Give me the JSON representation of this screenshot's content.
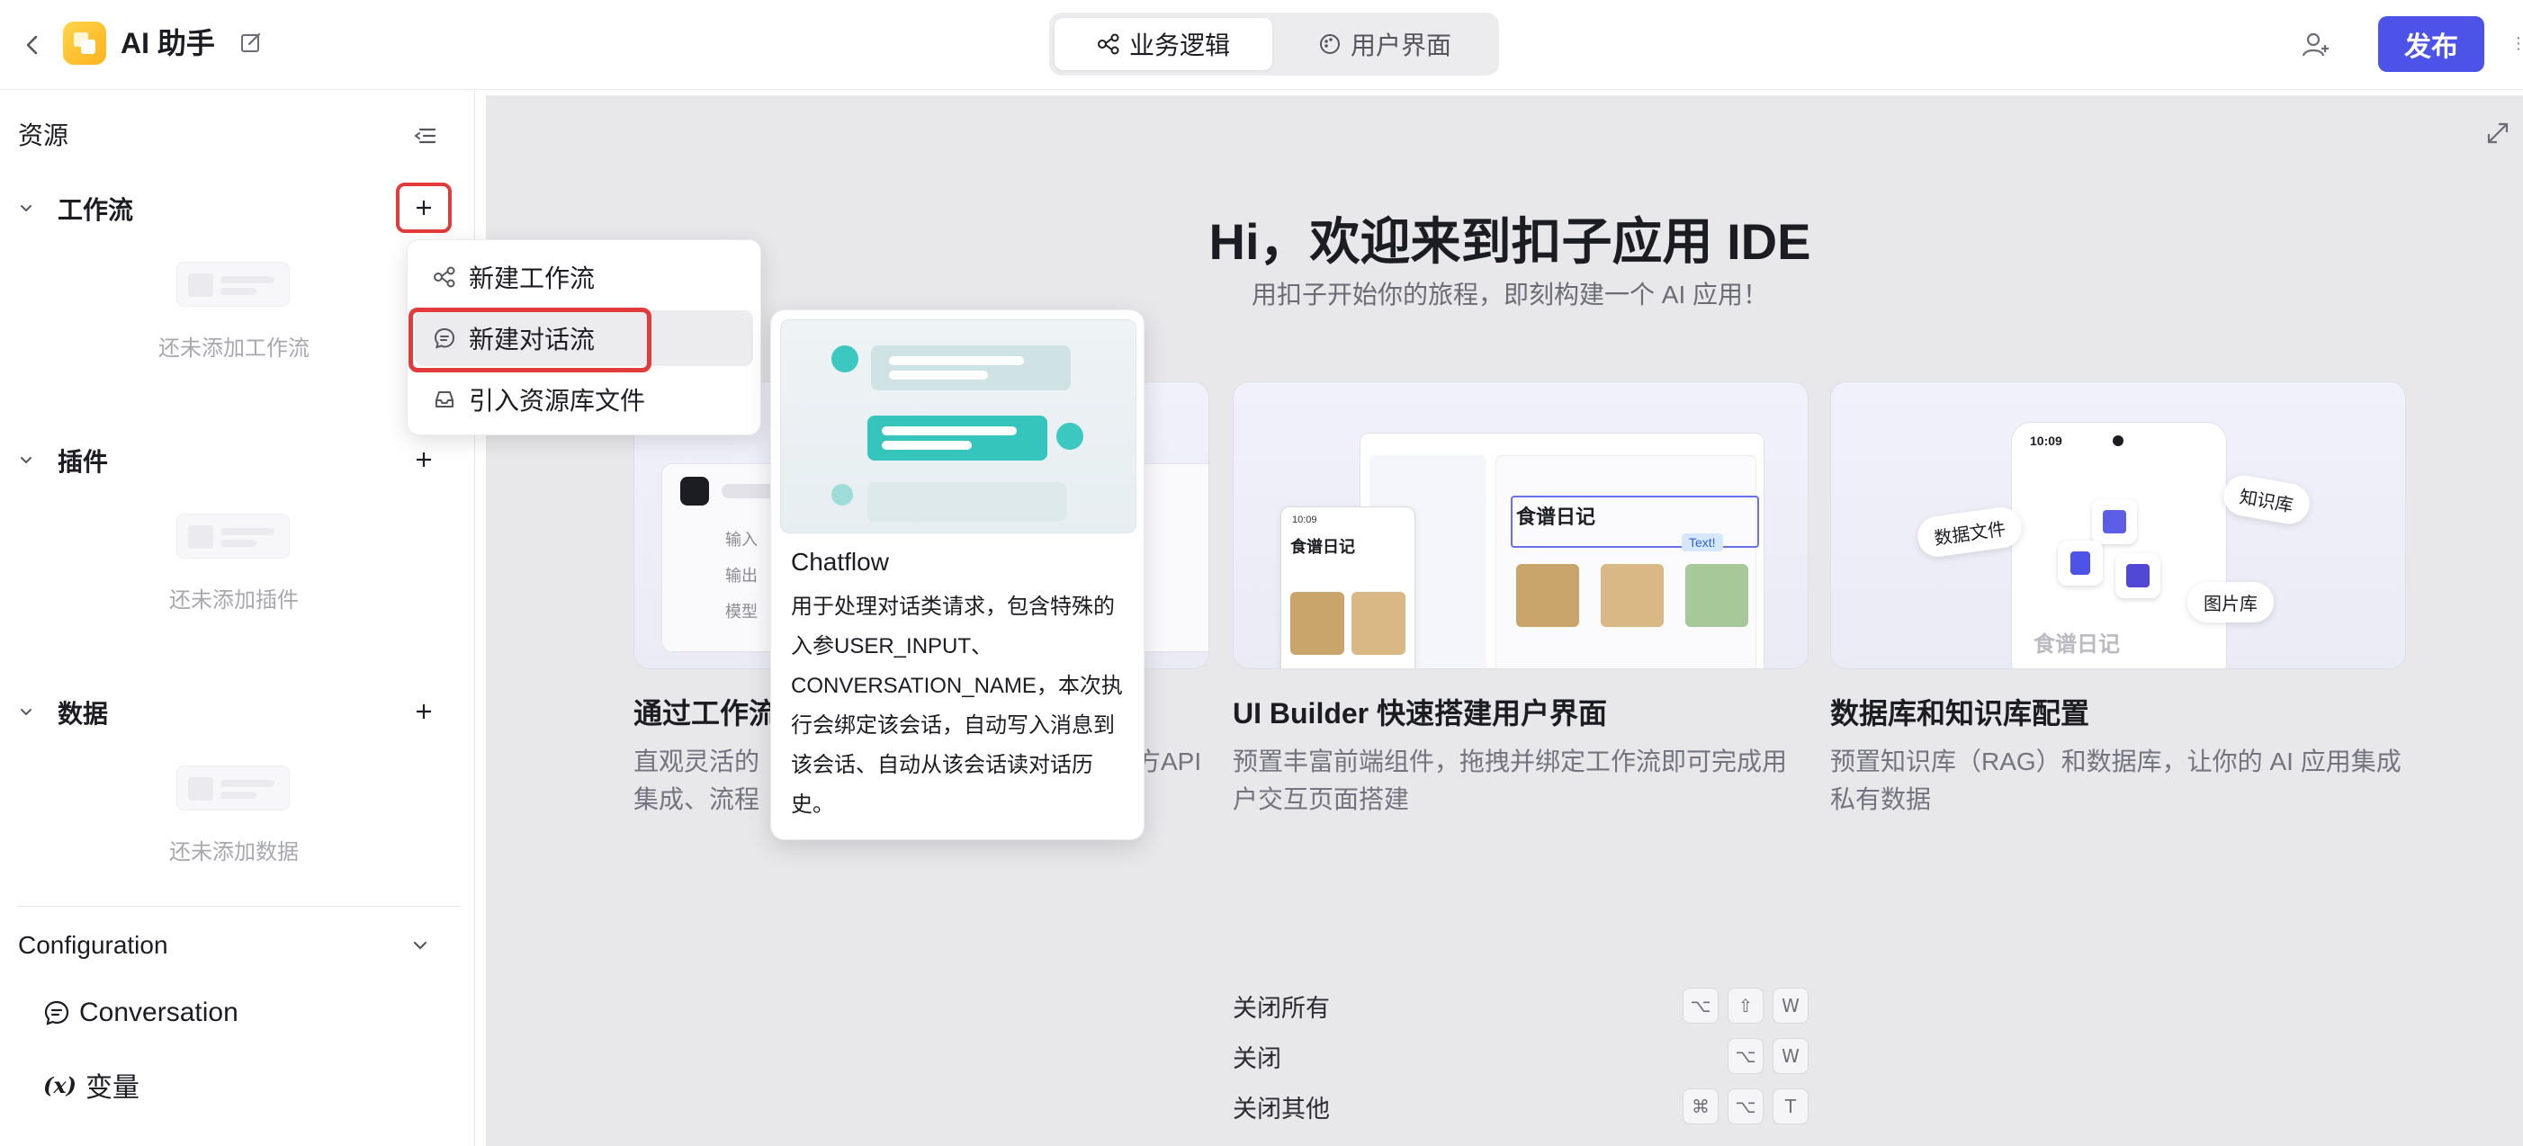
{
  "header": {
    "app_title": "AI 助手",
    "tabs": [
      {
        "label": "业务逻辑",
        "active": true
      },
      {
        "label": "用户界面",
        "active": false
      }
    ],
    "publish_label": "发布"
  },
  "sidebar": {
    "title": "资源",
    "sections": [
      {
        "label": "工作流",
        "empty_text": "还未添加工作流"
      },
      {
        "label": "插件",
        "empty_text": "还未添加插件"
      },
      {
        "label": "数据",
        "empty_text": "还未添加数据"
      }
    ],
    "configuration": {
      "label": "Configuration",
      "items": [
        {
          "label": "Conversation",
          "icon": "chat-bubble-icon"
        },
        {
          "label": "变量",
          "icon": "variable-x-icon"
        }
      ]
    }
  },
  "dropdown": {
    "items": [
      {
        "label": "新建工作流",
        "icon": "workflow-icon"
      },
      {
        "label": "新建对话流",
        "icon": "chatflow-icon"
      },
      {
        "label": "引入资源库文件",
        "icon": "inbox-icon"
      }
    ]
  },
  "tooltip": {
    "title": "Chatflow",
    "description": "用于处理对话类请求，包含特殊的入参USER_INPUT、CONVERSATION_NAME，本次执行会绑定该会话，自动写入消息到该会话、自动从该会话读对话历史。"
  },
  "main": {
    "hero_title": "Hi，欢迎来到扣子应用 IDE",
    "hero_subtitle": "用扣子开始你的旅程，即刻构建一个 AI 应用！",
    "cards": [
      {
        "title": "通过工作流",
        "desc_line1": "直观灵活的",
        "desc_line1_tail": "方API",
        "desc_line2": "集成、流程",
        "preview_labels": [
          "输入",
          "输出",
          "模型"
        ]
      },
      {
        "title": "UI Builder 快速搭建用户界面",
        "desc": "预置丰富前端组件，拖拽并绑定工作流即可完成用户交互页面搭建",
        "preview": {
          "phone_time": "10:09",
          "heading": "食谱日记",
          "big_heading": "食谱日记",
          "tag": "Text!"
        }
      },
      {
        "title": "数据库和知识库配置",
        "desc": "预置知识库（RAG）和数据库，让你的 AI 应用集成私有数据",
        "preview": {
          "phone_time": "10:09",
          "chip_a": "数据文件",
          "chip_b": "知识库",
          "chip_c": "图片库",
          "faded_title": "食谱日记"
        }
      }
    ],
    "shortcuts": [
      {
        "label": "关闭所有",
        "keys": [
          "⌥",
          "⇧",
          "W"
        ]
      },
      {
        "label": "关闭",
        "keys": [
          "⌥",
          "W"
        ]
      },
      {
        "label": "关闭其他",
        "keys": [
          "⌘",
          "⌥",
          "T"
        ]
      }
    ]
  },
  "colors": {
    "accent": "#4d53e8",
    "highlight_red": "#e23b3b",
    "canvas_bg": "#e8e8ea"
  }
}
